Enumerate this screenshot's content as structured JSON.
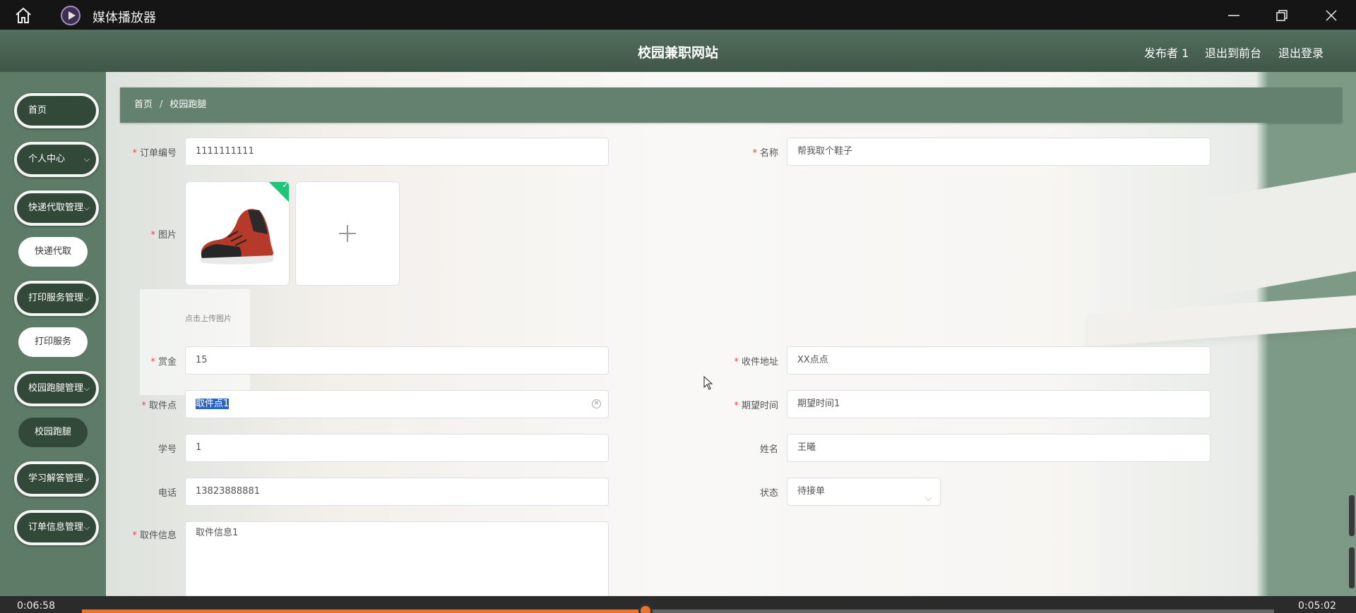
{
  "player": {
    "title": "媒体播放器",
    "time_elapsed": "0:06:58",
    "time_total": "0:05:02",
    "progress": 0.473
  },
  "header": {
    "site_title": "校园兼职网站",
    "user": "发布者 1",
    "to_front": "退出到前台",
    "logout": "退出登录"
  },
  "sidebar": {
    "items": [
      {
        "label": "首页"
      },
      {
        "label": "个人中心",
        "chevron": "⌵"
      },
      {
        "label": "快递代取管理",
        "chevron": "⌵"
      },
      {
        "label": "快递代取"
      },
      {
        "label": "打印服务管理",
        "chevron": "⌵"
      },
      {
        "label": "打印服务"
      },
      {
        "label": "校园跑腿管理",
        "chevron": "⌵"
      },
      {
        "label": "校园跑腿"
      },
      {
        "label": "学习解答管理",
        "chevron": "⌵"
      },
      {
        "label": "订单信息管理",
        "chevron": "⌵"
      }
    ]
  },
  "breadcrumb": {
    "home": "首页",
    "separator": "/",
    "current": "校园跑腿"
  },
  "form": {
    "required_mark": "*",
    "order_no": {
      "label": "订单编号",
      "value": "1111111111"
    },
    "name": {
      "label": "名称",
      "value": "帮我取个鞋子"
    },
    "image": {
      "label": "图片",
      "hint": "点击上传图片"
    },
    "reward": {
      "label": "赏金",
      "value": "15"
    },
    "address": {
      "label": "收件地址",
      "value": "XX点点"
    },
    "pickup_point": {
      "label": "取件点",
      "value": "取件点1"
    },
    "expected_time": {
      "label": "期望时间",
      "value": "期望时间1"
    },
    "student_id": {
      "label": "学号",
      "value": "1"
    },
    "real_name": {
      "label": "姓名",
      "value": "王曦"
    },
    "phone": {
      "label": "电话",
      "value": "13823888881"
    },
    "status": {
      "label": "状态",
      "value": "待接单"
    },
    "pickup_info": {
      "label": "取件信息",
      "value": "取件信息1"
    }
  },
  "colors": {
    "accent_dark": "#324838",
    "header": "#4a6555",
    "breadcrumb": "#64806e",
    "required": "#e5484d",
    "progress": "#e8742d",
    "upload_ok": "#21c47b"
  }
}
